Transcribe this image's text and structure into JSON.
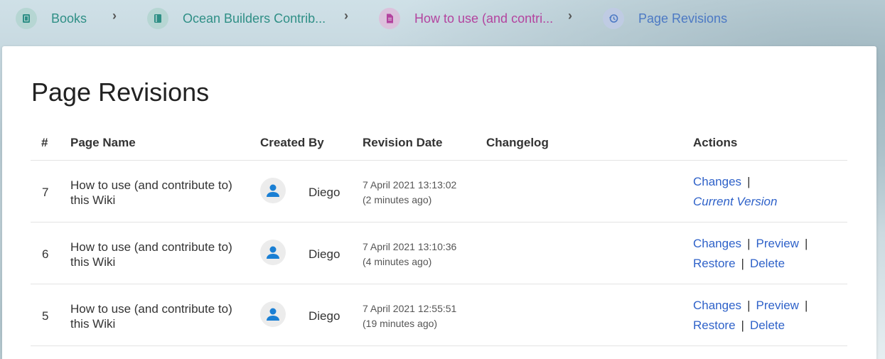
{
  "breadcrumb": {
    "items": [
      {
        "label": "Books",
        "icon": "book-shelf-icon"
      },
      {
        "label": "Ocean Builders Contrib...",
        "icon": "book-icon"
      },
      {
        "label": "How to use (and contri...",
        "icon": "page-icon"
      },
      {
        "label": "Page Revisions",
        "icon": "history-icon"
      }
    ]
  },
  "page": {
    "title": "Page Revisions"
  },
  "table": {
    "headers": {
      "num": "#",
      "page_name": "Page Name",
      "created_by": "Created By",
      "revision_date": "Revision Date",
      "changelog": "Changelog",
      "actions": "Actions"
    },
    "rows": [
      {
        "num": "7",
        "name": "How to use (and contribute to) this Wiki",
        "user": "Diego",
        "date": "7 April 2021 13:13:02",
        "ago": "(2 minutes ago)",
        "changelog": "",
        "actions": {
          "changes": "Changes",
          "current": "Current Version"
        }
      },
      {
        "num": "6",
        "name": "How to use (and contribute to) this Wiki",
        "user": "Diego",
        "date": "7 April 2021 13:10:36",
        "ago": "(4 minutes ago)",
        "changelog": "",
        "actions": {
          "changes": "Changes",
          "preview": "Preview",
          "restore": "Restore",
          "delete": "Delete"
        }
      },
      {
        "num": "5",
        "name": "How to use (and contribute to) this Wiki",
        "user": "Diego",
        "date": "7 April 2021 12:55:51",
        "ago": "(19 minutes ago)",
        "changelog": "",
        "actions": {
          "changes": "Changes",
          "preview": "Preview",
          "restore": "Restore",
          "delete": "Delete"
        }
      }
    ],
    "separator": "|"
  },
  "colors": {
    "books_accent": "#2f8f86",
    "page_accent": "#b3449f",
    "revision_accent": "#4c79c4",
    "link": "#2f62c9",
    "avatar": "#1a7fd4"
  }
}
